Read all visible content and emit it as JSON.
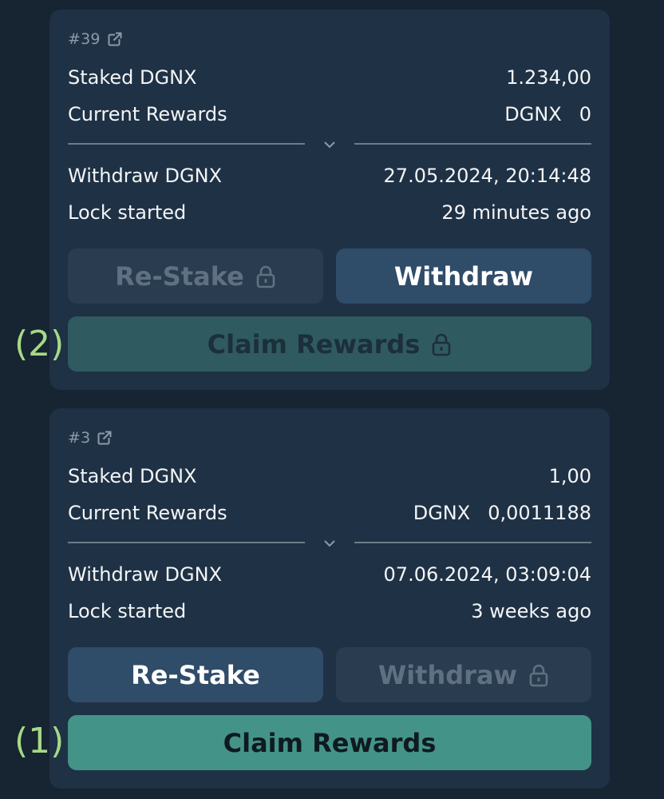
{
  "colors": {
    "page_bg": "#172431",
    "card_bg": "#1f3145",
    "primary_button": "#2f4c69",
    "disabled_button": "#2a3c50",
    "claim_active": "#449388",
    "claim_disabled": "#2f5a60",
    "annotation": "#a6d986"
  },
  "cards": [
    {
      "id": "#39",
      "staked_label": "Staked DGNX",
      "staked_value": "1.234,00",
      "rewards_label": "Current Rewards",
      "rewards_token": "DGNX",
      "rewards_value": "0",
      "withdraw_label": "Withdraw DGNX",
      "withdraw_value": "27.05.2024, 20:14:48",
      "lock_label": "Lock started",
      "lock_value": "29 minutes ago",
      "restake_label": "Re-Stake",
      "restake_locked": true,
      "withdraw_button_label": "Withdraw",
      "withdraw_locked": false,
      "claim_label": "Claim Rewards",
      "claim_locked": true,
      "annotation": "(2)"
    },
    {
      "id": "#3",
      "staked_label": "Staked DGNX",
      "staked_value": "1,00",
      "rewards_label": "Current Rewards",
      "rewards_token": "DGNX",
      "rewards_value": "0,0011188",
      "withdraw_label": "Withdraw DGNX",
      "withdraw_value": "07.06.2024, 03:09:04",
      "lock_label": "Lock started",
      "lock_value": "3 weeks ago",
      "restake_label": "Re-Stake",
      "restake_locked": false,
      "withdraw_button_label": "Withdraw",
      "withdraw_locked": true,
      "claim_label": "Claim Rewards",
      "claim_locked": false,
      "annotation": "(1)"
    }
  ],
  "icons": {
    "external": "external-link-icon",
    "lock": "lock-icon",
    "chevron": "chevron-down-icon"
  }
}
